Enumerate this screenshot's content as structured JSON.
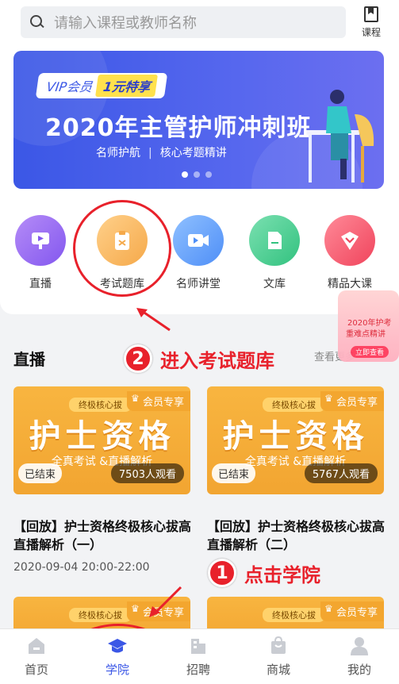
{
  "search": {
    "placeholder": "请输入课程或教师名称"
  },
  "header": {
    "course_label": "课程"
  },
  "banner": {
    "vip_tag": "VIP会员",
    "vip_offer": "1元特享",
    "title": "2020年主管护师冲刺班",
    "subtitle_left": "名师护航",
    "subtitle_sep": "|",
    "subtitle_right": "核心考题精讲",
    "pages": 3,
    "active_page": 1
  },
  "categories": [
    {
      "label": "直播",
      "icon": "live-icon",
      "color": "#9b6df3"
    },
    {
      "label": "考试题库",
      "icon": "exam-bank-icon",
      "color": "#f8b25c"
    },
    {
      "label": "名师讲堂",
      "icon": "video-lecture-icon",
      "color": "#4f8ff7"
    },
    {
      "label": "文库",
      "icon": "document-icon",
      "color": "#3cc58a"
    },
    {
      "label": "精品大课",
      "icon": "premium-course-icon",
      "color": "#f5566b"
    }
  ],
  "live": {
    "section_title": "直播",
    "see_more": "查看更多",
    "items": [
      {
        "strip": "终极核心拔",
        "vip": "会员专享",
        "big": "护士资格",
        "small": "全真考试 &直播解析",
        "status": "已结束",
        "views": "7503人观看",
        "title": "【回放】护士资格终极核心拔高直播解析（一）",
        "time": "2020-09-04 20:00-22:00"
      },
      {
        "strip": "终极核心拔",
        "vip": "会员专享",
        "big": "护士资格",
        "small": "全真考试 &直播解析",
        "status": "已结束",
        "views": "5767人观看",
        "title": "【回放】护士资格终极核心拔高直播解析（二）",
        "time": ""
      },
      {
        "strip": "终极核心拔",
        "vip": "会员专享"
      },
      {
        "strip": "终极核心拔",
        "vip": "会员专享"
      }
    ]
  },
  "annotations": {
    "step2_num": "2",
    "step2_text": "进入考试题库",
    "step1_num": "1",
    "step1_text": "点击学院"
  },
  "promo": {
    "line1": "2020年护考",
    "line2": "重难点精讲",
    "cta": "立即查看"
  },
  "tabbar": [
    {
      "label": "首页",
      "icon": "home-icon"
    },
    {
      "label": "学院",
      "icon": "academy-icon",
      "active": true
    },
    {
      "label": "招聘",
      "icon": "recruit-icon"
    },
    {
      "label": "商城",
      "icon": "shop-icon"
    },
    {
      "label": "我的",
      "icon": "profile-icon"
    }
  ],
  "colors": {
    "accent": "#3b57e6",
    "annotation_red": "#e8212b",
    "thumb_orange": "#f2a531"
  }
}
